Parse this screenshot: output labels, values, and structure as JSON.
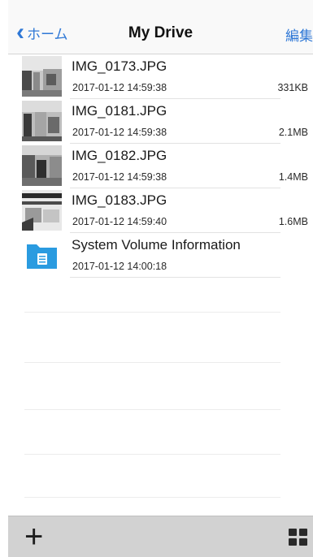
{
  "nav": {
    "back_label": "ホーム",
    "title": "My Drive",
    "edit_label": "編集"
  },
  "files": [
    {
      "name": "IMG_0173.JPG",
      "date": "2017-01-12 14:59:38",
      "size": "331KB",
      "icon": "photo-thumbnail"
    },
    {
      "name": "IMG_0181.JPG",
      "date": "2017-01-12 14:59:38",
      "size": "2.1MB",
      "icon": "photo-thumbnail"
    },
    {
      "name": "IMG_0182.JPG",
      "date": "2017-01-12 14:59:38",
      "size": "1.4MB",
      "icon": "photo-thumbnail"
    },
    {
      "name": "IMG_0183.JPG",
      "date": "2017-01-12 14:59:40",
      "size": "1.6MB",
      "icon": "photo-thumbnail"
    },
    {
      "name": "System Volume Information",
      "date": "2017-01-12 14:00:18",
      "size": "",
      "icon": "folder-icon"
    }
  ],
  "toolbar": {
    "add_icon": "plus-icon",
    "view_icon": "grid-view-icon"
  },
  "colors": {
    "accent": "#2f78d6",
    "folder": "#2a9be0",
    "toolbar": "#d2d2d2"
  }
}
